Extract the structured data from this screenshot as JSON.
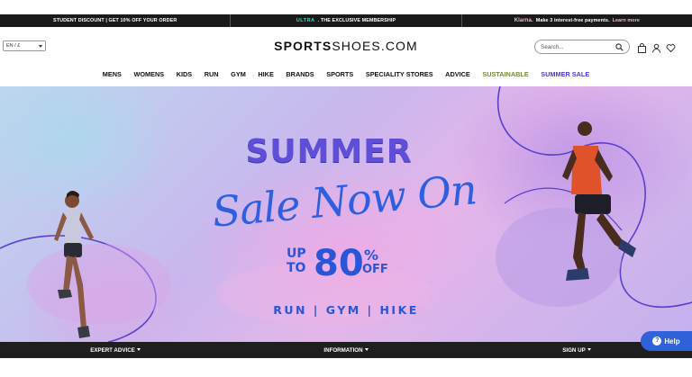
{
  "promo": {
    "student": "STUDENT DISCOUNT | GET 10% OFF YOUR ORDER",
    "ultra_brand": "ULTRA",
    "ultra_text": ". THE EXCLUSIVE MEMBERSHIP",
    "klarna_brand": "Klarna.",
    "klarna_text": "Make 3 interest-free payments.",
    "klarna_link": "Learn more"
  },
  "header": {
    "language": "EN / £",
    "logo_bold": "SPORTS",
    "logo_light": "SHOES.COM",
    "search_placeholder": "Search..."
  },
  "nav": {
    "items": [
      "MENS",
      "WOMENS",
      "KIDS",
      "RUN",
      "GYM",
      "HIKE",
      "BRANDS",
      "SPORTS",
      "SPECIALITY STORES",
      "ADVICE",
      "SUSTAINABLE",
      "SUMMER SALE"
    ]
  },
  "hero": {
    "headline": "SUMMER",
    "script": "Sale Now On",
    "up": "UP",
    "to": "TO",
    "amount": "80",
    "percent": "%",
    "off": "OFF",
    "tagline": "RUN | GYM | HIKE"
  },
  "footer": {
    "items": [
      "EXPERT ADVICE",
      "INFORMATION",
      "SIGN UP"
    ]
  },
  "help": {
    "label": "Help"
  },
  "colors": {
    "accent": "#2f62d9",
    "sale": "#4a3adb",
    "sustainable": "#6f8a3c"
  }
}
